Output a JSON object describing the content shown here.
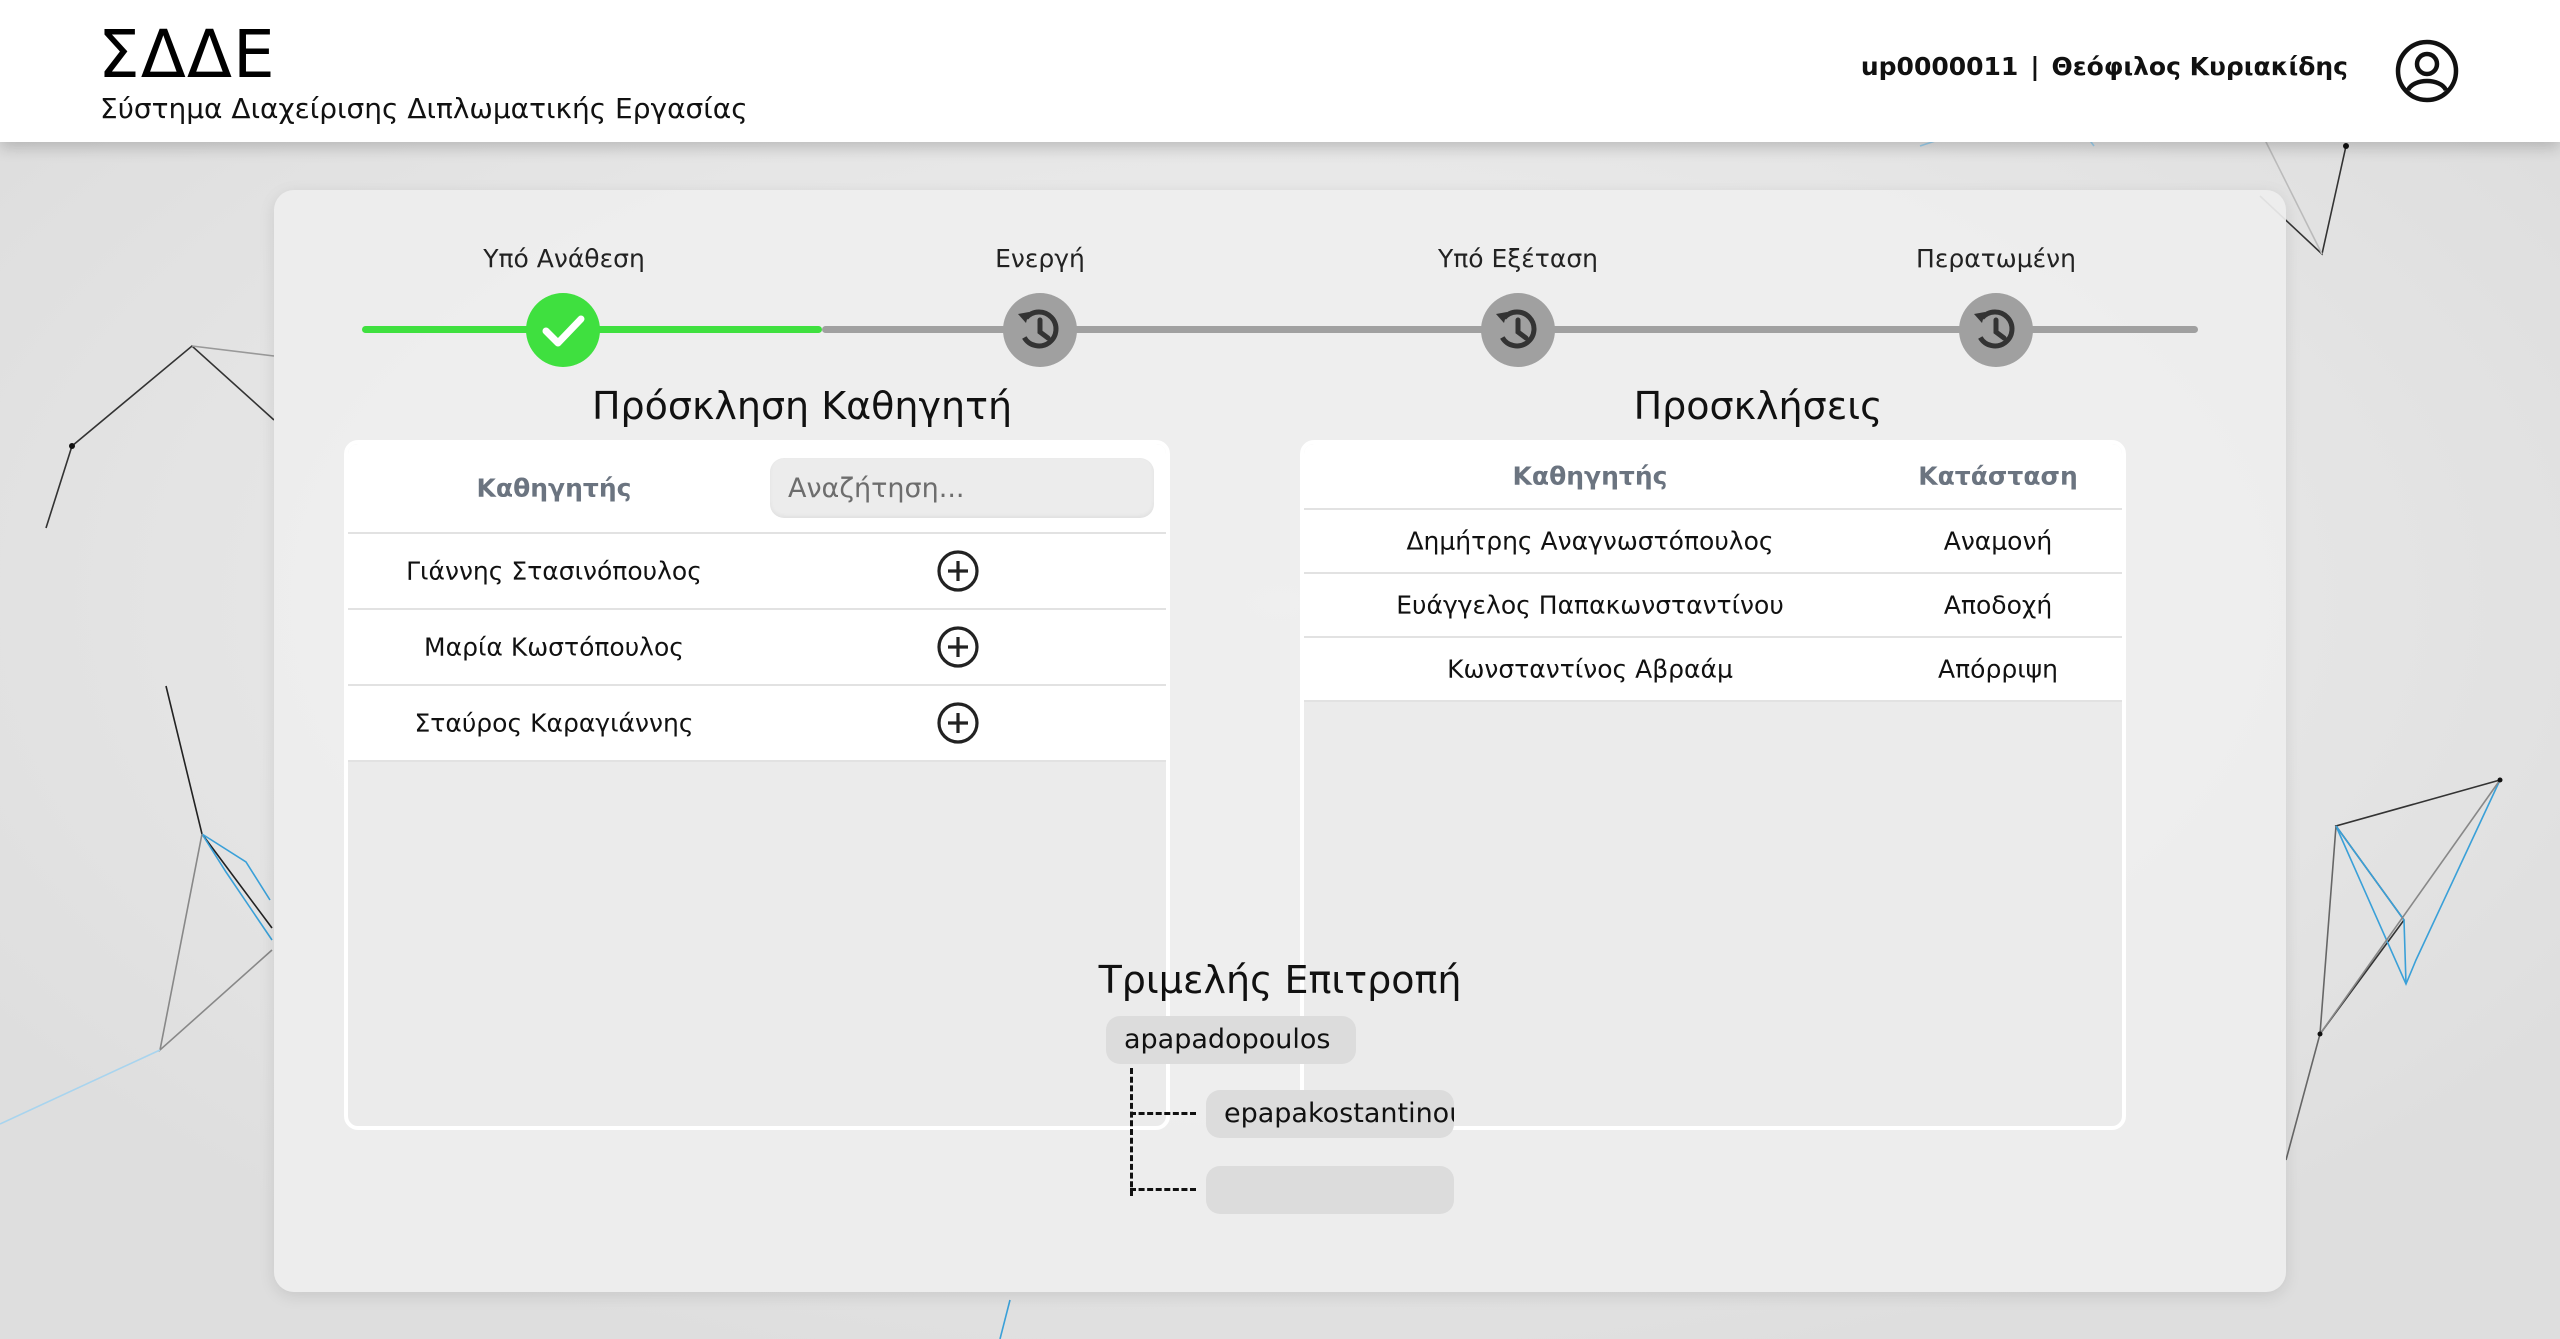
{
  "app": {
    "logo": "ΣΔΔΕ",
    "subtitle": "Σύστημα Διαχείρισης Διπλωματικής Εργασίας"
  },
  "user": {
    "id": "up0000011",
    "separator": "|",
    "name": "Θεόφιλος Κυριακίδης",
    "avatar_icon": "user-circle-icon"
  },
  "progress": {
    "completed_color": "#3fe03f",
    "pending_color": "#a0a0a0",
    "steps": [
      {
        "label": "Υπό Ανάθεση",
        "status": "completed",
        "icon": "check-icon"
      },
      {
        "label": "Ενεργή",
        "status": "pending",
        "icon": "history-icon"
      },
      {
        "label": "Υπό Εξέταση",
        "status": "pending",
        "icon": "history-icon"
      },
      {
        "label": "Περατωμένη",
        "status": "pending",
        "icon": "history-icon"
      }
    ]
  },
  "invite": {
    "title": "Πρόσκληση Καθηγητή",
    "column_header": "Καθηγητής",
    "search_placeholder": "Αναζήτηση...",
    "add_icon": "plus-circle-icon",
    "professors": [
      "Γιάννης Στασινόπουλος",
      "Μαρία Κωστόπουλος",
      "Σταύρος Καραγιάννης"
    ]
  },
  "invitations": {
    "title": "Προσκλήσεις",
    "headers": [
      "Καθηγητής",
      "Κατάσταση"
    ],
    "rows": [
      [
        "Δημήτρης Αναγνωστόπουλος",
        "Αναμονή"
      ],
      [
        "Ευάγγελος Παπακωνσταντίνου",
        "Αποδοχή"
      ],
      [
        "Κωνσταντίνος Αβραάμ",
        "Απόρριψη"
      ]
    ]
  },
  "committee": {
    "title": "Τριμελής Επιτροπή",
    "supervisor": "apapadopoulos",
    "members": [
      "epapakostantinou",
      ""
    ]
  }
}
